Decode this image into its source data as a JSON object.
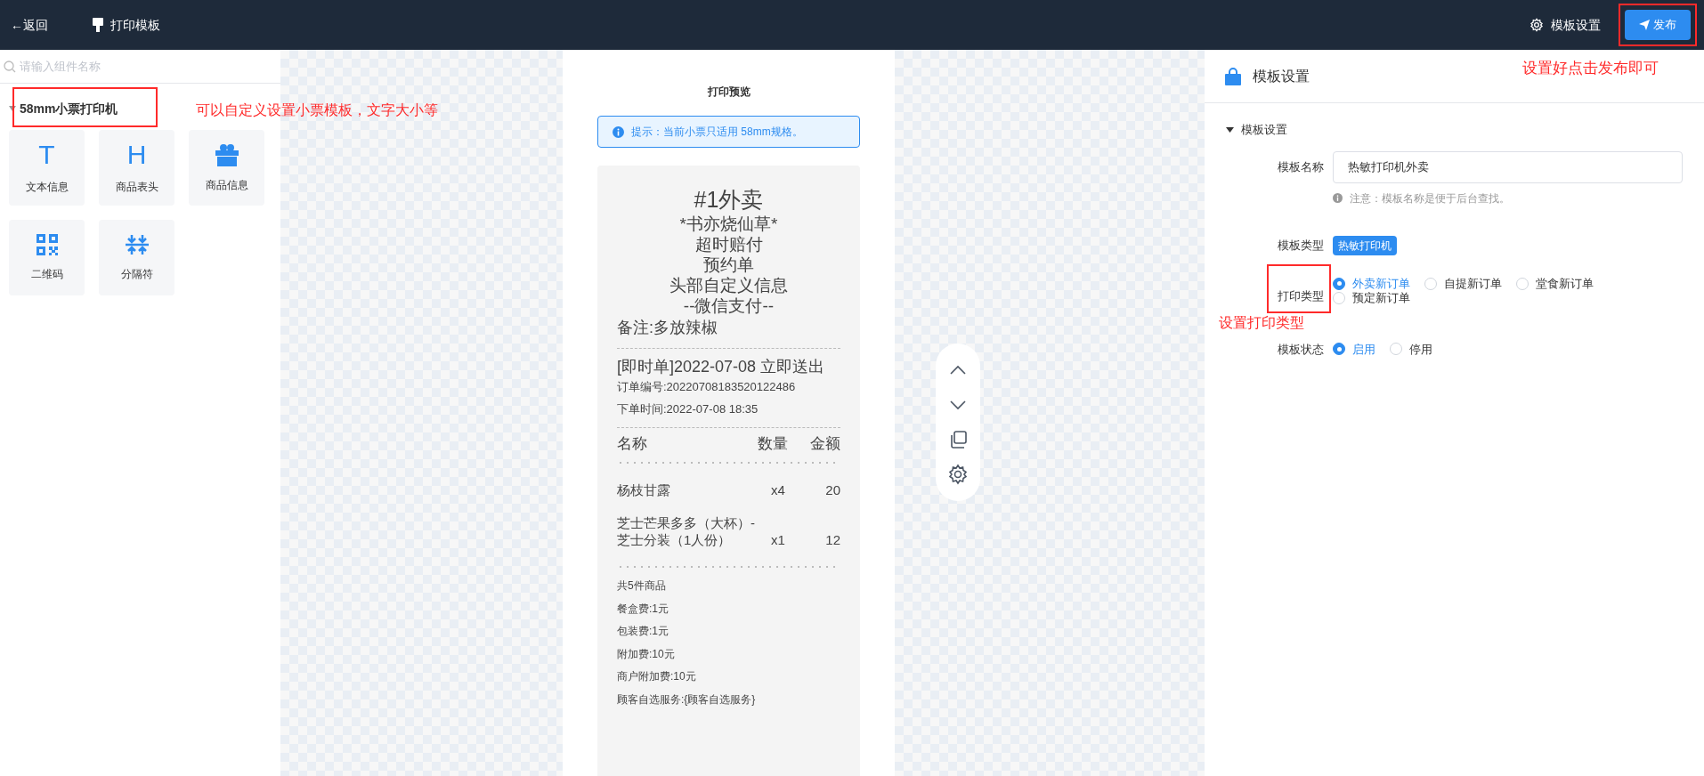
{
  "header": {
    "back_label": "←返回",
    "title": "打印模板",
    "settings_label": "模板设置",
    "publish": {
      "label": "发布",
      "highlighted": true
    }
  },
  "components": {
    "search_placeholder": "请输入组件名称",
    "group": {
      "label": "58mm小票打印机",
      "expanded": true,
      "highlighted": true
    },
    "items": [
      {
        "label": "文本信息",
        "kind": "text",
        "glyph": "T"
      },
      {
        "label": "商品表头",
        "kind": "heading",
        "glyph": "H"
      },
      {
        "label": "商品信息",
        "kind": "gift"
      },
      {
        "label": "二维码",
        "kind": "qrcode"
      },
      {
        "label": "分隔符",
        "kind": "divider"
      }
    ]
  },
  "preview": {
    "title": "打印预览",
    "notice": "提示：当前小票只适用 58mm规格。",
    "receipt": {
      "title": "#1外卖",
      "header_lines": [
        "*书亦烧仙草*",
        "超时赔付",
        "预约单",
        "头部自定义信息",
        "--微信支付--"
      ],
      "remark": "备注:多放辣椒",
      "order_line": "[即时单]2022-07-08 立即送出",
      "details": [
        "订单编号:20220708183520122486",
        "下单时间:2022-07-08 18:35"
      ],
      "columns": [
        "名称",
        "数量",
        "金额"
      ],
      "items": [
        {
          "name": "杨枝甘露",
          "qty": "x4",
          "amount": "20"
        },
        {
          "name": "芝士芒果多多（大杯）-芝士分装（1人份）",
          "qty": "x1",
          "amount": "12"
        }
      ],
      "summary": [
        "共5件商品",
        "餐盒费:1元",
        "包装费:1元",
        "附加费:10元",
        "商户附加费:10元",
        "顾客自选服务:{顾客自选服务}"
      ]
    }
  },
  "toolbar": [
    {
      "kind": "up"
    },
    {
      "kind": "down"
    },
    {
      "kind": "copy"
    },
    {
      "kind": "settings"
    }
  ],
  "settings": {
    "title": "模板设置",
    "section": {
      "label": "模板设置",
      "expanded": true
    },
    "name": {
      "label": "模板名称",
      "value": "热敏打印机外卖",
      "hint": "注意：模板名称是便于后台查找。"
    },
    "type": {
      "label": "模板类型",
      "tag": "热敏打印机"
    },
    "print_type": {
      "label": "打印类型",
      "highlighted": true,
      "options": [
        {
          "label": "外卖新订单",
          "selected": true
        },
        {
          "label": "自提新订单",
          "selected": false
        },
        {
          "label": "堂食新订单",
          "selected": false
        },
        {
          "label": "预定新订单",
          "selected": false
        }
      ]
    },
    "status": {
      "label": "模板状态",
      "options": [
        {
          "label": "启用",
          "selected": true
        },
        {
          "label": "停用",
          "selected": false
        }
      ]
    }
  },
  "annotations": {
    "components": "可以自定义设置小票模板，文字大小等",
    "publish": "设置好点击发布即可",
    "print_type": "设置打印类型"
  }
}
